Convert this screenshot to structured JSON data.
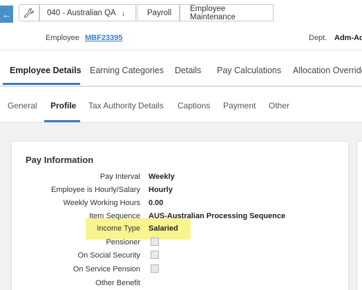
{
  "breadcrumb": {
    "company": "040 - Australian QA",
    "module": "Payroll",
    "page": "Employee Maintenance"
  },
  "employee": {
    "label": "Employee",
    "id": "MBF23395",
    "dept_label": "Dept.",
    "dept_value": "Adm-Adm"
  },
  "main_tabs": [
    "Employee Details",
    "Earning Categories",
    "Details",
    "Pay Calculations",
    "Allocation Overrides"
  ],
  "sub_tabs": [
    "General",
    "Profile",
    "Tax Authority Details",
    "Captions",
    "Payment",
    "Other"
  ],
  "pay_info": {
    "title": "Pay Information",
    "rows": [
      {
        "label": "Pay Interval",
        "value": "Weekly"
      },
      {
        "label": "Employee is Hourly/Salary",
        "value": "Hourly"
      },
      {
        "label": "Weekly Working Hours",
        "value": "0.00"
      },
      {
        "label": "Item Sequence",
        "value": "AUS-Australian Processing Sequence"
      },
      {
        "label": "Income Type",
        "value": "Salaried"
      },
      {
        "label": "Pensioner",
        "checked": false
      },
      {
        "label": "On Social Security",
        "checked": false
      },
      {
        "label": "On Service Pension",
        "checked": false
      },
      {
        "label": "Other Benefit"
      }
    ]
  },
  "colors": {
    "accent": "#3a7bbf",
    "highlight": "#f7f58f"
  },
  "icons": {
    "back": "arrow-left-icon",
    "wrench": "wrench-icon",
    "dropdown": "arrow-down-icon"
  }
}
